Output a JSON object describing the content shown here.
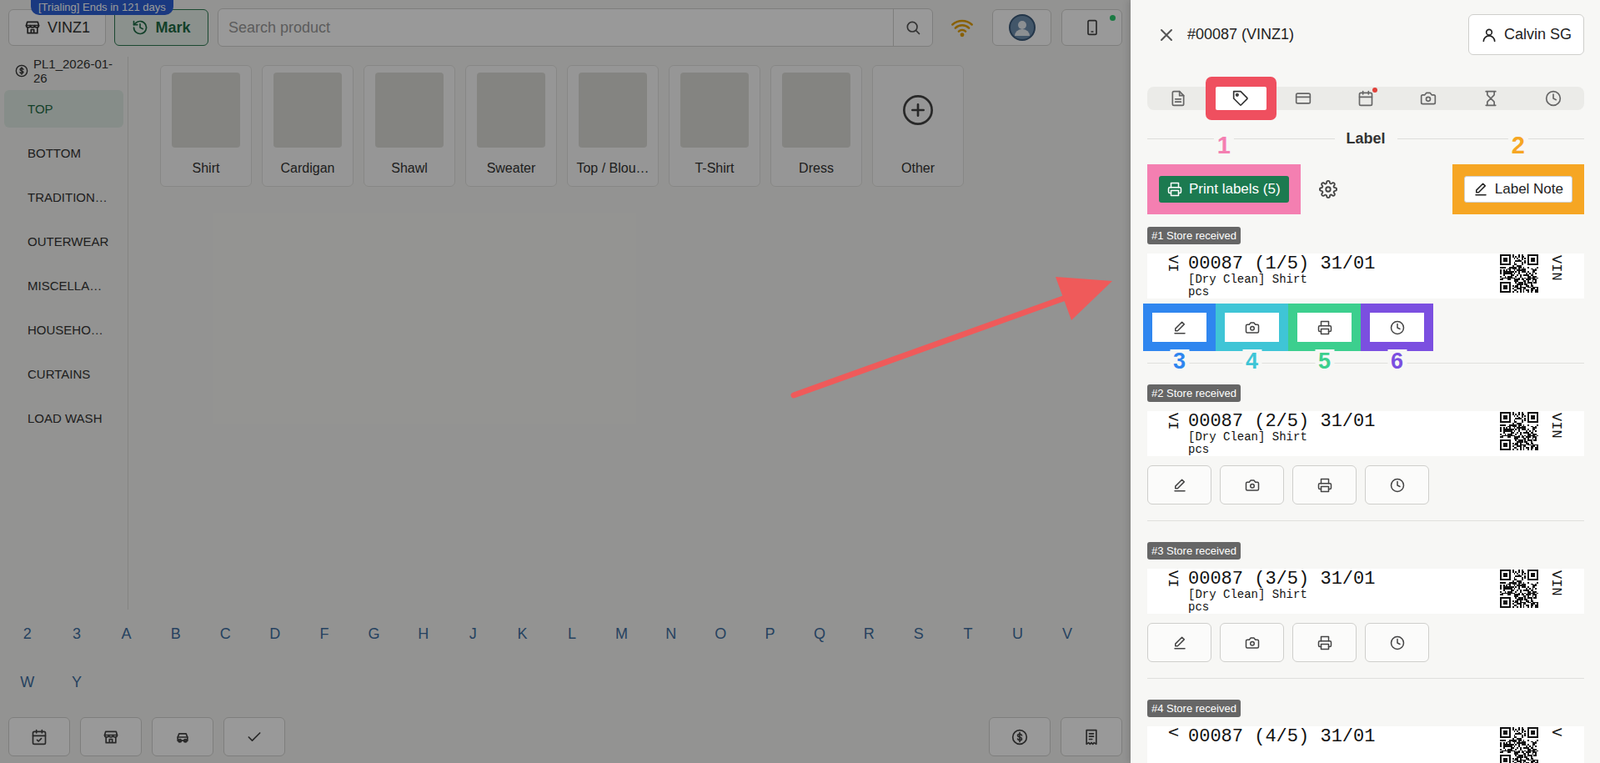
{
  "app": {
    "trial_badge": "[Trialing] Ends in 121 days",
    "store_button": "VINZ1",
    "mark_button": "Mark",
    "search": {
      "placeholder": "Search product"
    },
    "device_online": true,
    "price_list": "PL1_2026-01-26",
    "categories": [
      {
        "label": "TOP",
        "selected": true
      },
      {
        "label": "BOTTOM",
        "selected": false
      },
      {
        "label": "TRADITION…",
        "selected": false
      },
      {
        "label": "OUTERWEAR",
        "selected": false
      },
      {
        "label": "MISCELLA…",
        "selected": false
      },
      {
        "label": "HOUSEHO…",
        "selected": false
      },
      {
        "label": "CURTAINS",
        "selected": false
      },
      {
        "label": "LOAD WASH",
        "selected": false
      }
    ],
    "products": [
      {
        "label": "Shirt",
        "kind": "photo"
      },
      {
        "label": "Cardigan",
        "kind": "photo"
      },
      {
        "label": "Shawl",
        "kind": "photo"
      },
      {
        "label": "Sweater",
        "kind": "photo"
      },
      {
        "label": "Top / Blou…",
        "kind": "photo"
      },
      {
        "label": "T-Shirt",
        "kind": "photo"
      },
      {
        "label": "Dress",
        "kind": "photo"
      },
      {
        "label": "Other",
        "kind": "add"
      }
    ],
    "letters": [
      "2",
      "3",
      "A",
      "B",
      "C",
      "D",
      "F",
      "G",
      "H",
      "J",
      "K",
      "L",
      "M",
      "N",
      "O",
      "P",
      "Q",
      "R",
      "S",
      "T",
      "U",
      "V",
      "W",
      "Y"
    ],
    "dimmed": true
  },
  "drawer": {
    "title": "#00087 (VINZ1)",
    "user_button": "Calvin SG",
    "tabs": [
      {
        "selected": false,
        "dot": false
      },
      {
        "selected": true,
        "dot": false
      },
      {
        "selected": false,
        "dot": false
      },
      {
        "selected": false,
        "dot": true
      },
      {
        "selected": false,
        "dot": false
      },
      {
        "selected": false,
        "dot": false
      },
      {
        "selected": false,
        "dot": false
      }
    ],
    "section_title": "Label",
    "print_button": {
      "label": "Print labels (5)",
      "annotation": {
        "number": "1",
        "color": "#f47fb1"
      }
    },
    "label_note_button": {
      "label": "Label Note",
      "annotation": {
        "number": "2",
        "color": "#f6a623"
      }
    },
    "labels": [
      {
        "status": "#1 Store received",
        "code": "00087 (1/5) 31/01",
        "service": "[Dry Clean] Shirt",
        "unit": "pcs",
        "edge_left": "VI",
        "edge_right": "VIN",
        "actions_visible": true,
        "action_annotations": [
          {
            "number": "3",
            "color": "#2f86ef"
          },
          {
            "number": "4",
            "color": "#3fc5d6"
          },
          {
            "number": "5",
            "color": "#3ccf8e"
          },
          {
            "number": "6",
            "color": "#7b4fe0"
          }
        ]
      },
      {
        "status": "#2 Store received",
        "code": "00087 (2/5) 31/01",
        "service": "[Dry Clean] Shirt",
        "unit": "pcs",
        "edge_left": "VI",
        "edge_right": "VIN",
        "actions_visible": true,
        "action_annotations": []
      },
      {
        "status": "#3 Store received",
        "code": "00087 (3/5) 31/01",
        "service": "[Dry Clean] Shirt",
        "unit": "pcs",
        "edge_left": "VI",
        "edge_right": "VIN",
        "actions_visible": true,
        "action_annotations": []
      },
      {
        "status": "#4 Store received",
        "code": "00087 (4/5) 31/01",
        "edge_left": "V",
        "edge_right": "V",
        "actions_visible": false,
        "action_annotations": []
      }
    ]
  },
  "highlights": {
    "selected_tab_color": "#ef4f5f",
    "arrow_color": "#ef5a5a"
  }
}
